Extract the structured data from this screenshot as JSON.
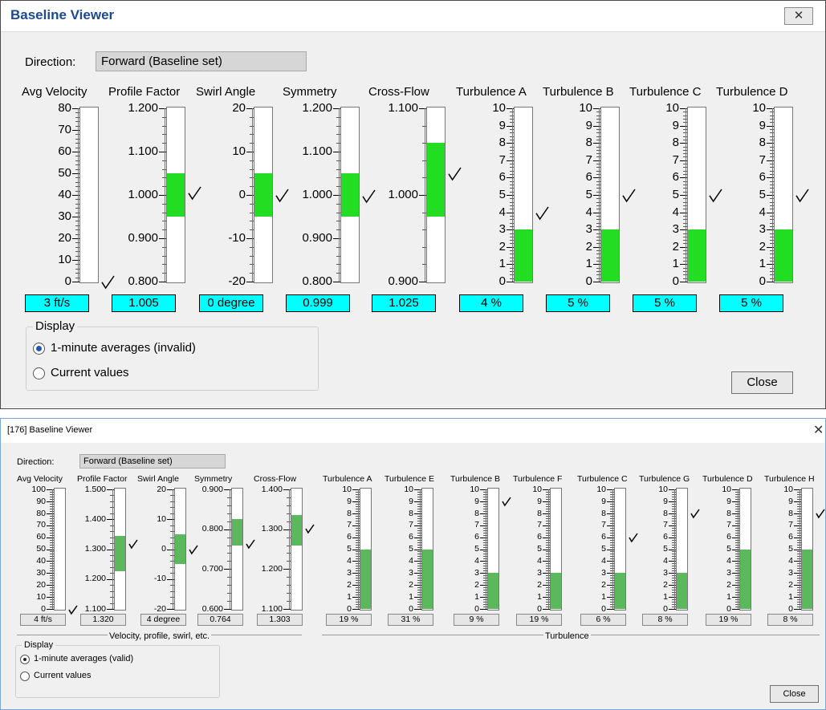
{
  "window1": {
    "title": "Baseline Viewer",
    "close_icon": "close-x-icon",
    "direction_label": "Direction:",
    "direction_value": "Forward (Baseline set)",
    "fill_color": "#22dd22",
    "value_color": "#00ffff",
    "gauges": [
      {
        "title": "Avg Velocity",
        "ticks": [
          "80",
          "70",
          "60",
          "50",
          "40",
          "30",
          "20",
          "10",
          "0"
        ],
        "min": 0,
        "max": 80,
        "fill": null,
        "marker": 0,
        "value": "3 ft/s"
      },
      {
        "title": "Profile Factor",
        "ticks": [
          "1.200",
          "1.100",
          "1.000",
          "0.900",
          "0.800"
        ],
        "min": 0.8,
        "max": 1.2,
        "fill": [
          0.95,
          1.05
        ],
        "marker": 1.005,
        "value": "1.005"
      },
      {
        "title": "Swirl Angle",
        "ticks": [
          "20",
          "10",
          "0",
          "-10",
          "-20"
        ],
        "min": -20,
        "max": 20,
        "fill": [
          -5,
          5
        ],
        "marker": 0,
        "value": "0 degree"
      },
      {
        "title": "Symmetry",
        "ticks": [
          "1.200",
          "1.100",
          "1.000",
          "0.900",
          "0.800"
        ],
        "min": 0.8,
        "max": 1.2,
        "fill": [
          0.95,
          1.05
        ],
        "marker": 0.999,
        "value": "0.999"
      },
      {
        "title": "Cross-Flow",
        "ticks": [
          "1.100",
          "1.000",
          "0.900"
        ],
        "min": 0.9,
        "max": 1.1,
        "fill": [
          0.975,
          1.06
        ],
        "marker": 1.025,
        "value": "1.025"
      },
      {
        "title": "Turbulence A",
        "ticks": [
          "10",
          "9",
          "8",
          "7",
          "6",
          "5",
          "4",
          "3",
          "2",
          "1",
          "0"
        ],
        "min": 0,
        "max": 10,
        "fill": [
          0,
          3
        ],
        "marker": 4,
        "value": "4 %"
      },
      {
        "title": "Turbulence B",
        "ticks": [
          "10",
          "9",
          "8",
          "7",
          "6",
          "5",
          "4",
          "3",
          "2",
          "1",
          "0"
        ],
        "min": 0,
        "max": 10,
        "fill": [
          0,
          3
        ],
        "marker": 5,
        "value": "5 %"
      },
      {
        "title": "Turbulence C",
        "ticks": [
          "10",
          "9",
          "8",
          "7",
          "6",
          "5",
          "4",
          "3",
          "2",
          "1",
          "0"
        ],
        "min": 0,
        "max": 10,
        "fill": [
          0,
          3
        ],
        "marker": 5,
        "value": "5 %"
      },
      {
        "title": "Turbulence D",
        "ticks": [
          "10",
          "9",
          "8",
          "7",
          "6",
          "5",
          "4",
          "3",
          "2",
          "1",
          "0"
        ],
        "min": 0,
        "max": 10,
        "fill": [
          0,
          3
        ],
        "marker": 5,
        "value": "5 %"
      }
    ],
    "display_group": "Display",
    "radio_options": [
      {
        "label": "1-minute averages (invalid)",
        "selected": true
      },
      {
        "label": "Current values",
        "selected": false
      }
    ],
    "close_button": "Close"
  },
  "window2": {
    "title": "[176] Baseline Viewer",
    "close_icon": "close-x-icon",
    "direction_label": "Direction:",
    "direction_value": "Forward (Baseline set)",
    "fill_color": "#5cb85c",
    "value_color": "#e6e6e6",
    "gauges": [
      {
        "title": "Avg Velocity",
        "ticks": [
          "100",
          "90",
          "80",
          "70",
          "60",
          "50",
          "40",
          "30",
          "20",
          "10",
          "0"
        ],
        "min": 0,
        "max": 100,
        "fill": null,
        "marker": 0,
        "value": "4 ft/s"
      },
      {
        "title": "Profile Factor",
        "ticks": [
          "1.500",
          "1.400",
          "1.300",
          "1.200",
          "1.100"
        ],
        "min": 1.1,
        "max": 1.5,
        "fill": [
          1.225,
          1.345
        ],
        "marker": 1.32,
        "value": "1.320"
      },
      {
        "title": "Swirl Angle",
        "ticks": [
          "20",
          "10",
          "0",
          "-10",
          "-20"
        ],
        "min": -20,
        "max": 20,
        "fill": [
          -5,
          5
        ],
        "marker": 0,
        "value": "4 degree"
      },
      {
        "title": "Symmetry",
        "ticks": [
          "0.900",
          "0.800",
          "0.700",
          "0.600"
        ],
        "min": 0.6,
        "max": 0.9,
        "fill": [
          0.76,
          0.825
        ],
        "marker": 0.764,
        "value": "0.764"
      },
      {
        "title": "Cross-Flow",
        "ticks": [
          "1.400",
          "1.300",
          "1.200",
          "1.100"
        ],
        "min": 1.1,
        "max": 1.4,
        "fill": [
          1.26,
          1.335
        ],
        "marker": 1.303,
        "value": "1.303"
      },
      {
        "title": "Turbulence A",
        "ticks": [
          "10",
          "9",
          "8",
          "7",
          "6",
          "5",
          "4",
          "3",
          "2",
          "1",
          "0"
        ],
        "min": 0,
        "max": 10,
        "fill": [
          0,
          5
        ],
        "marker": null,
        "value": "19 %"
      },
      {
        "title": "Turbulence E",
        "ticks": [
          "10",
          "9",
          "8",
          "7",
          "6",
          "5",
          "4",
          "3",
          "2",
          "1",
          "0"
        ],
        "min": 0,
        "max": 10,
        "fill": [
          0,
          5
        ],
        "marker": null,
        "value": "31 %"
      },
      {
        "title": "Turbulence B",
        "ticks": [
          "10",
          "9",
          "8",
          "7",
          "6",
          "5",
          "4",
          "3",
          "2",
          "1",
          "0"
        ],
        "min": 0,
        "max": 10,
        "fill": [
          0,
          3
        ],
        "marker": 9,
        "value": "9 %"
      },
      {
        "title": "Turbulence F",
        "ticks": [
          "10",
          "9",
          "8",
          "7",
          "6",
          "5",
          "4",
          "3",
          "2",
          "1",
          "0"
        ],
        "min": 0,
        "max": 10,
        "fill": [
          0,
          3
        ],
        "marker": null,
        "value": "19 %"
      },
      {
        "title": "Turbulence C",
        "ticks": [
          "10",
          "9",
          "8",
          "7",
          "6",
          "5",
          "4",
          "3",
          "2",
          "1",
          "0"
        ],
        "min": 0,
        "max": 10,
        "fill": [
          0,
          3
        ],
        "marker": 6,
        "value": "6 %"
      },
      {
        "title": "Turbulence G",
        "ticks": [
          "10",
          "9",
          "8",
          "7",
          "6",
          "5",
          "4",
          "3",
          "2",
          "1",
          "0"
        ],
        "min": 0,
        "max": 10,
        "fill": [
          0,
          3
        ],
        "marker": 8,
        "value": "8 %"
      },
      {
        "title": "Turbulence D",
        "ticks": [
          "10",
          "9",
          "8",
          "7",
          "6",
          "5",
          "4",
          "3",
          "2",
          "1",
          "0"
        ],
        "min": 0,
        "max": 10,
        "fill": [
          0,
          5
        ],
        "marker": null,
        "value": "19 %"
      },
      {
        "title": "Turbulence H",
        "ticks": [
          "10",
          "9",
          "8",
          "7",
          "6",
          "5",
          "4",
          "3",
          "2",
          "1",
          "0"
        ],
        "min": 0,
        "max": 10,
        "fill": [
          0,
          5
        ],
        "marker": 8,
        "value": "8 %"
      }
    ],
    "section_labels": [
      "Velocity, profile, swirl, etc.",
      "Turbulence"
    ],
    "display_group": "Display",
    "radio_options": [
      {
        "label": "1-minute averages (valid)",
        "selected": true
      },
      {
        "label": "Current values",
        "selected": false
      }
    ],
    "close_button": "Close"
  }
}
